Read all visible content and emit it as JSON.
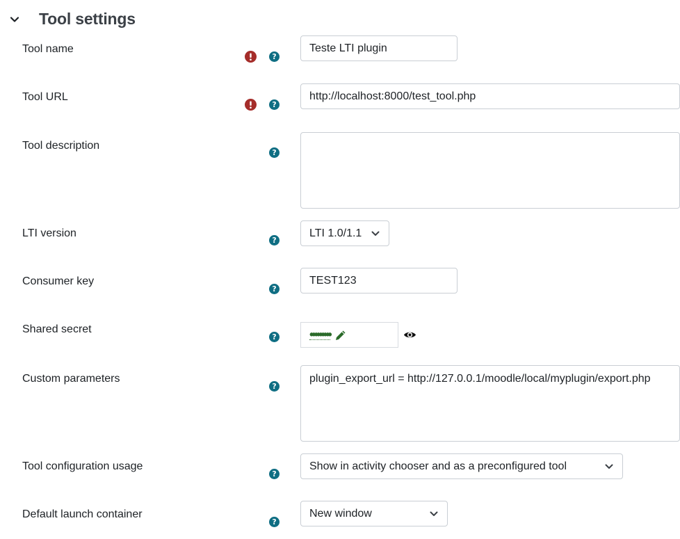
{
  "section": {
    "title": "Tool settings"
  },
  "fields": {
    "tool_name": {
      "label": "Tool name",
      "value": "Teste LTI plugin"
    },
    "tool_url": {
      "label": "Tool URL",
      "value": "http://localhost:8000/test_tool.php"
    },
    "tool_description": {
      "label": "Tool description",
      "value": ""
    },
    "lti_version": {
      "label": "LTI version",
      "value": "LTI 1.0/1.1"
    },
    "consumer_key": {
      "label": "Consumer key",
      "value": "TEST123"
    },
    "shared_secret": {
      "label": "Shared secret",
      "masked": "•••••••••"
    },
    "custom_parameters": {
      "label": "Custom parameters",
      "value": "plugin_export_url = http://127.0.0.1/moodle/local/myplugin/export.php"
    },
    "tool_configuration_usage": {
      "label": "Tool configuration usage",
      "value": "Show in activity chooser and as a preconfigured tool"
    },
    "default_launch_container": {
      "label": "Default launch container",
      "value": "New window"
    }
  },
  "icons": {
    "required": "exclamation-circle-icon",
    "help": "question-circle-icon",
    "collapse": "chevron-down-icon",
    "edit": "pencil-icon",
    "reveal": "eye-icon"
  },
  "colors": {
    "required": "#a52d2a",
    "help": "#0f6e83",
    "secret": "#2b6b2a",
    "border": "#c9ced4",
    "title": "#3b4046"
  }
}
